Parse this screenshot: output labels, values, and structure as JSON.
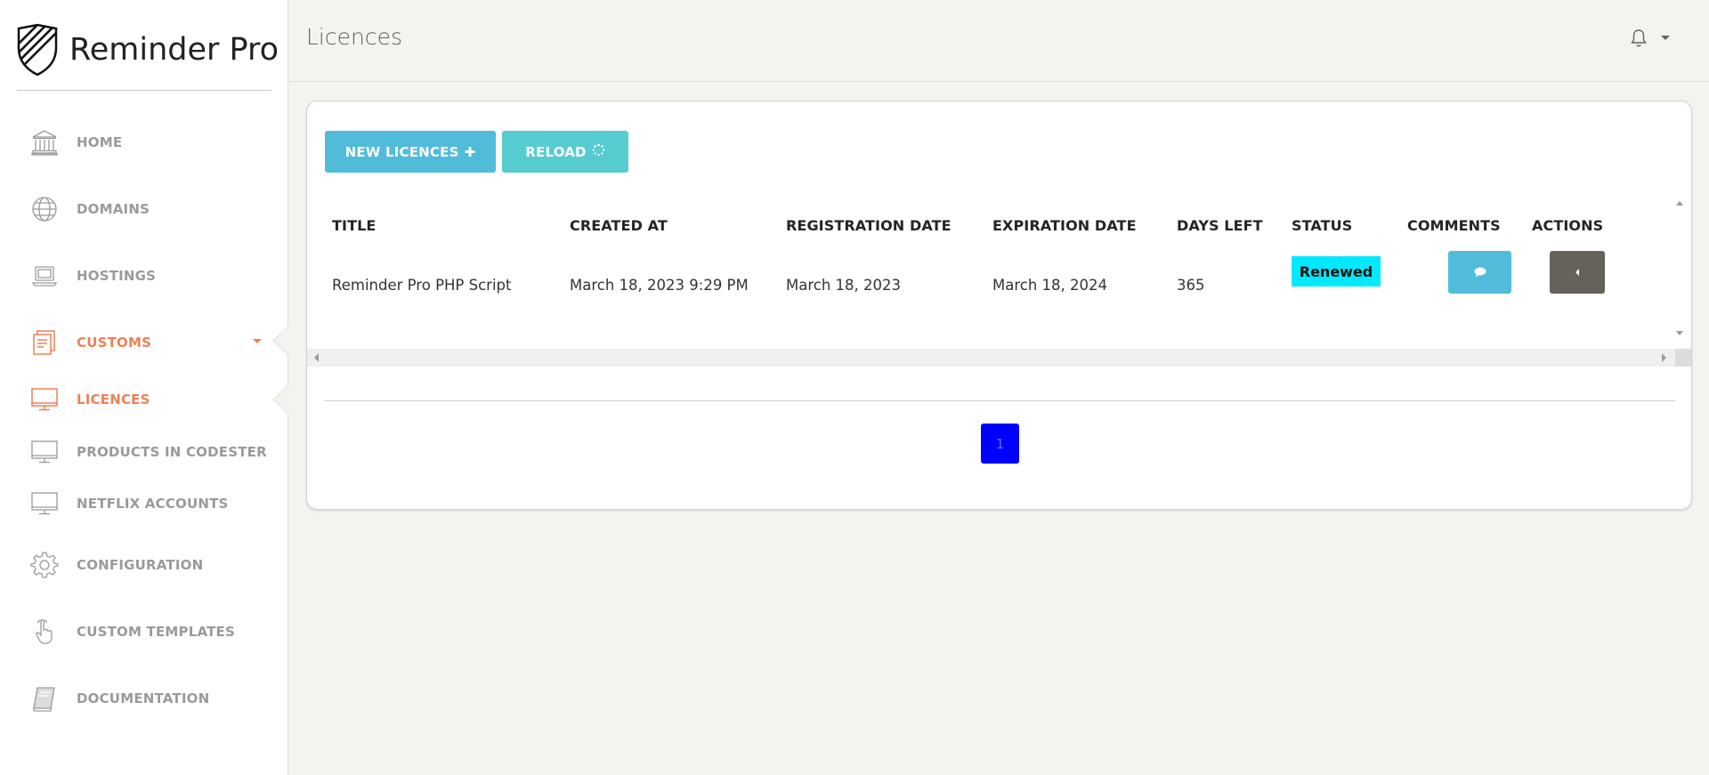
{
  "app": {
    "name": "Reminder Pro",
    "page_title": "Licences"
  },
  "colors": {
    "accent": "#ef8157",
    "info": "#51bcda",
    "success": "#56ccd0",
    "badge_renewed": "#00e9ff",
    "page_link": "#0000ff",
    "sidebar_text": "#9a9a9a"
  },
  "sidebar": {
    "items": [
      {
        "label": "HOME",
        "icon": "bank-icon",
        "active": false
      },
      {
        "label": "DOMAINS",
        "icon": "globe-icon",
        "active": false
      },
      {
        "label": "HOSTINGS",
        "icon": "laptop-icon",
        "active": false
      },
      {
        "label": "CUSTOMS",
        "icon": "paper-icon",
        "active": true,
        "expandable": true
      },
      {
        "label": "LICENCES",
        "icon": "monitor-icon",
        "active": true
      },
      {
        "label": "PRODUCTS IN CODESTER",
        "icon": "monitor-icon",
        "active": false
      },
      {
        "label": "NETFLIX ACCOUNTS",
        "icon": "monitor-icon",
        "active": false
      },
      {
        "label": "CONFIGURATION",
        "icon": "gear-icon",
        "active": false
      },
      {
        "label": "CUSTOM TEMPLATES",
        "icon": "hand-pointer-icon",
        "active": false
      },
      {
        "label": "DOCUMENTATION",
        "icon": "book-icon",
        "active": false
      }
    ]
  },
  "header": {
    "notification_icon": "bell-icon"
  },
  "toolbar": {
    "new_label": "NEW LICENCES",
    "new_icon": "plus-icon",
    "reload_label": "RELOAD",
    "reload_icon": "spinner-icon"
  },
  "table": {
    "columns": [
      "TITLE",
      "CREATED AT",
      "REGISTRATION DATE",
      "EXPIRATION DATE",
      "DAYS LEFT",
      "STATUS",
      "COMMENTS",
      "ACTIONS"
    ],
    "rows": [
      {
        "title": "Reminder Pro PHP Script",
        "created_at": "March 18, 2023 9:29 PM",
        "registration_date": "March 18, 2023",
        "expiration_date": "March 18, 2024",
        "days_left": "365",
        "status": "Renewed",
        "comments_icon": "comment-icon",
        "actions_icon": "caret-left-icon"
      }
    ]
  },
  "pagination": {
    "current_page": "1"
  }
}
